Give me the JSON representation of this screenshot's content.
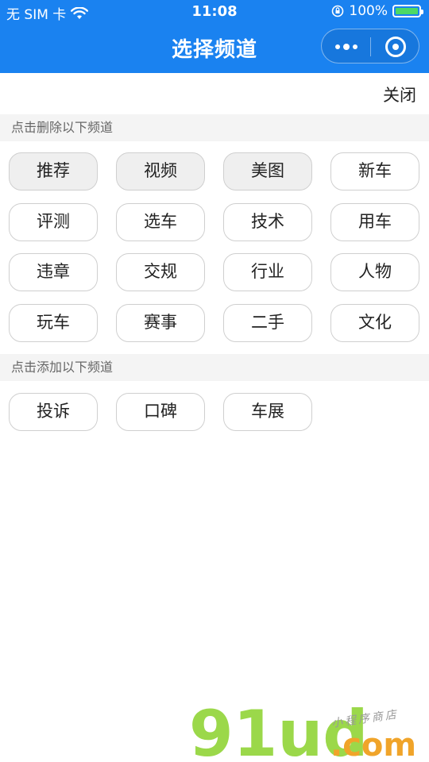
{
  "status_bar": {
    "carrier": "无 SIM 卡",
    "time": "11:08",
    "battery_percent": "100%",
    "battery_level": 1.0
  },
  "navbar": {
    "title": "选择频道"
  },
  "close_label": "关闭",
  "my_channels": {
    "header": "点击删除以下频道",
    "items": [
      {
        "label": "推荐",
        "fixed": true
      },
      {
        "label": "视频",
        "fixed": true
      },
      {
        "label": "美图",
        "fixed": true
      },
      {
        "label": "新车",
        "fixed": false
      },
      {
        "label": "评测",
        "fixed": false
      },
      {
        "label": "选车",
        "fixed": false
      },
      {
        "label": "技术",
        "fixed": false
      },
      {
        "label": "用车",
        "fixed": false
      },
      {
        "label": "违章",
        "fixed": false
      },
      {
        "label": "交规",
        "fixed": false
      },
      {
        "label": "行业",
        "fixed": false
      },
      {
        "label": "人物",
        "fixed": false
      },
      {
        "label": "玩车",
        "fixed": false
      },
      {
        "label": "赛事",
        "fixed": false
      },
      {
        "label": "二手",
        "fixed": false
      },
      {
        "label": "文化",
        "fixed": false
      }
    ]
  },
  "more_channels": {
    "header": "点击添加以下频道",
    "items": [
      {
        "label": "投诉"
      },
      {
        "label": "口碑"
      },
      {
        "label": "车展"
      }
    ]
  },
  "watermark": {
    "logo": "91ud",
    "suffix": ".com",
    "tagline": "小程序商店"
  },
  "colors": {
    "primary": "#1a82f0",
    "battery": "#4cd964",
    "chip_fixed": "#efefef",
    "section_bg": "#f4f4f4"
  }
}
